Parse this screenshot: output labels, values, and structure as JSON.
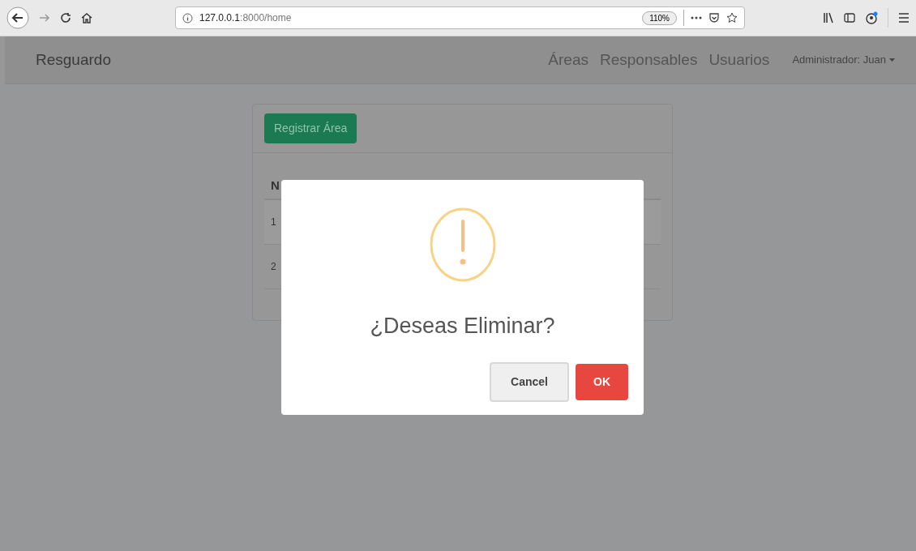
{
  "browser": {
    "url_host": "127.0.0.1",
    "url_path": ":8000/home",
    "zoom": "110%"
  },
  "navbar": {
    "brand": "Resguardo",
    "links": [
      "Áreas",
      "Responsables",
      "Usuarios"
    ],
    "user_menu": "Administrador: Juan"
  },
  "card": {
    "button": "Registrar Área",
    "table": {
      "columns": [
        "N"
      ],
      "rows": [
        {
          "column_1": "1"
        },
        {
          "column_1": "2"
        }
      ]
    }
  },
  "dialog": {
    "title": "¿Deseas Eliminar?",
    "buttons": [
      {
        "kind": "cancel",
        "label": "Cancel"
      },
      {
        "kind": "confirm",
        "label": "OK"
      }
    ]
  }
}
